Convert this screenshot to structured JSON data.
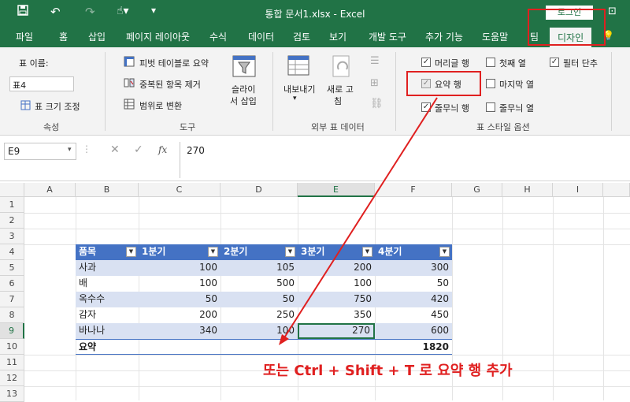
{
  "titlebar": {
    "title": "통합 문서1.xlsx  -  Excel",
    "login_label": "로그인"
  },
  "tabs": [
    "파일",
    "홈",
    "삽입",
    "페이지 레이아웃",
    "수식",
    "데이터",
    "검토",
    "보기",
    "개발 도구",
    "추가 기능",
    "도움말",
    "팀",
    "디자인"
  ],
  "ribbon": {
    "properties": {
      "table_name_label": "표 이름:",
      "table_name_value": "표4",
      "resize_label": "표 크기 조정",
      "group_label": "속성"
    },
    "tools": {
      "pivot_label": "피벗 테이블로 요약",
      "remove_dup_label": "중복된 항목 제거",
      "convert_range_label": "범위로 변환",
      "slicer_label_1": "슬라이",
      "slicer_label_2": "서 삽입",
      "group_label": "도구"
    },
    "external": {
      "export_label": "내보내기",
      "refresh_label_1": "새로 고",
      "refresh_label_2": "침",
      "group_label": "외부 표 데이터"
    },
    "style_options": {
      "header_row": "머리글 행",
      "total_row": "요약 행",
      "banded_rows": "줄무늬 행",
      "first_col": "첫째 열",
      "last_col": "마지막 열",
      "banded_cols": "줄무늬 열",
      "filter_button": "필터 단추",
      "group_label": "표 스타일 옵션"
    }
  },
  "formula_bar": {
    "name_box": "E9",
    "formula": "270",
    "fx": "fx"
  },
  "grid": {
    "columns": [
      "A",
      "B",
      "C",
      "D",
      "E",
      "F",
      "G",
      "H",
      "I"
    ],
    "rows": [
      "1",
      "2",
      "3",
      "4",
      "5",
      "6",
      "7",
      "8",
      "9",
      "10",
      "11",
      "12",
      "13"
    ]
  },
  "table": {
    "headers": [
      "품목",
      "1분기",
      "2분기",
      "3분기",
      "4분기"
    ],
    "rows": [
      [
        "사과",
        "100",
        "105",
        "200",
        "300"
      ],
      [
        "배",
        "100",
        "500",
        "100",
        "50"
      ],
      [
        "옥수수",
        "50",
        "50",
        "750",
        "420"
      ],
      [
        "감자",
        "200",
        "250",
        "350",
        "450"
      ],
      [
        "바나나",
        "340",
        "100",
        "270",
        "600"
      ]
    ],
    "total_label": "요약",
    "total_value": "1820"
  },
  "annotation": {
    "text": "또는 Ctrl + Shift + T 로 요약 행 추가",
    "color": "#e02020"
  }
}
